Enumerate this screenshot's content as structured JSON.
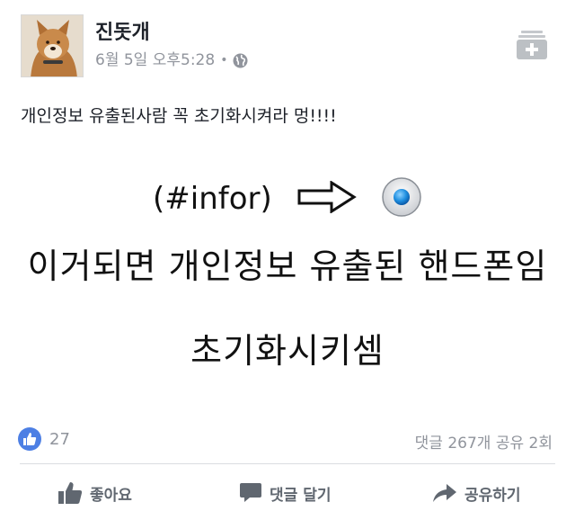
{
  "post": {
    "author": "진돗개",
    "timestamp": "6월 5일 오후5:28",
    "separator": "•",
    "privacy_icon": "globe-icon",
    "text": "개인정보 유출된사람 꼭 초기화시켜라 멍!!!!"
  },
  "image": {
    "tag": "(#infor)",
    "line2": "이거되면 개인정보 유출된 핸드폰임",
    "line3": "초기화시키셈"
  },
  "reactions": {
    "count": "27",
    "stats": "댓글 267개 공유 2회"
  },
  "actions": {
    "like": "좋아요",
    "comment": "댓글 달기",
    "share": "공유하기"
  },
  "colors": {
    "like_blue": "#4d7fe4",
    "muted_text": "#90949c",
    "action_gray": "#606770",
    "radio_blue": "#1f8fe0"
  }
}
